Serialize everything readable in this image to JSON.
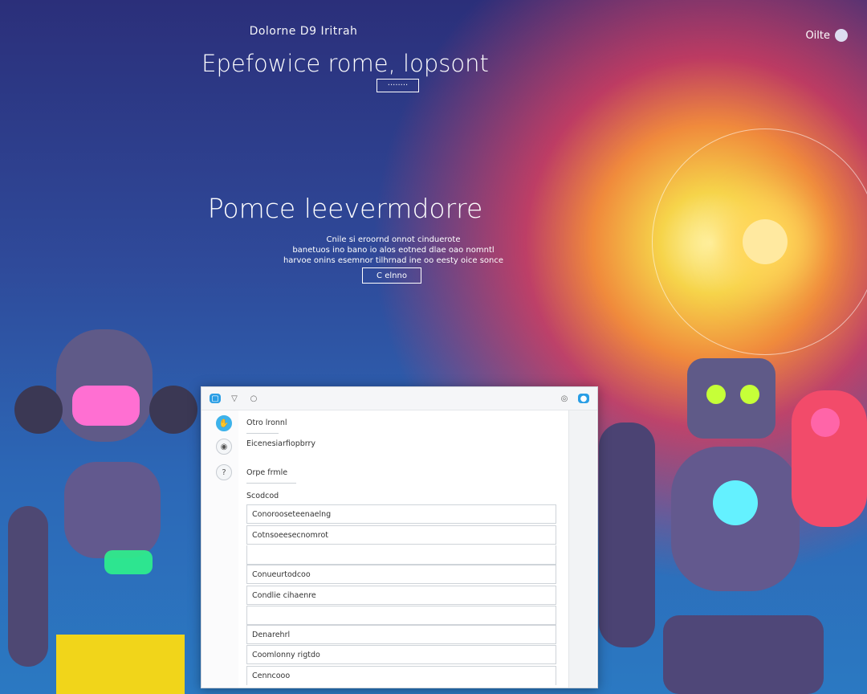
{
  "hero": {
    "kicker": "Dolorne D9 Iritrah",
    "title": "Epefowice rome, lopsont",
    "button": "········"
  },
  "section": {
    "title": "Pomce leevermdorre",
    "blurb_lines": [
      "Cnile si eroornd onnot cinduerote",
      "banetuos ino bano io alos eotned dlae oao nomntl",
      "harvoe onins esemnor tilhrnad ine oo eesty oice sonce"
    ],
    "button": "C elnno"
  },
  "topright": {
    "label": "Oilte"
  },
  "panel": {
    "toolbar_icons": [
      "app-icon",
      "filter-icon",
      "pin-icon"
    ],
    "toolbar_right_icons": [
      "settings-icon",
      "chat-icon"
    ],
    "fields": [
      {
        "label": "Otro lronnl"
      },
      {
        "label": "Eicenesiarfiopbrry"
      },
      {
        "label": "Orpe frmle"
      },
      {
        "label": "Scodcod"
      }
    ],
    "rows": [
      "Conorooseteenaelng",
      "Cotnsoeesecnomrot",
      "",
      "Conueurtodcoo",
      "Condlie cihaenre",
      "",
      "Denarehrl",
      "Coomlonny rigtdo",
      "Cenncooo"
    ]
  }
}
